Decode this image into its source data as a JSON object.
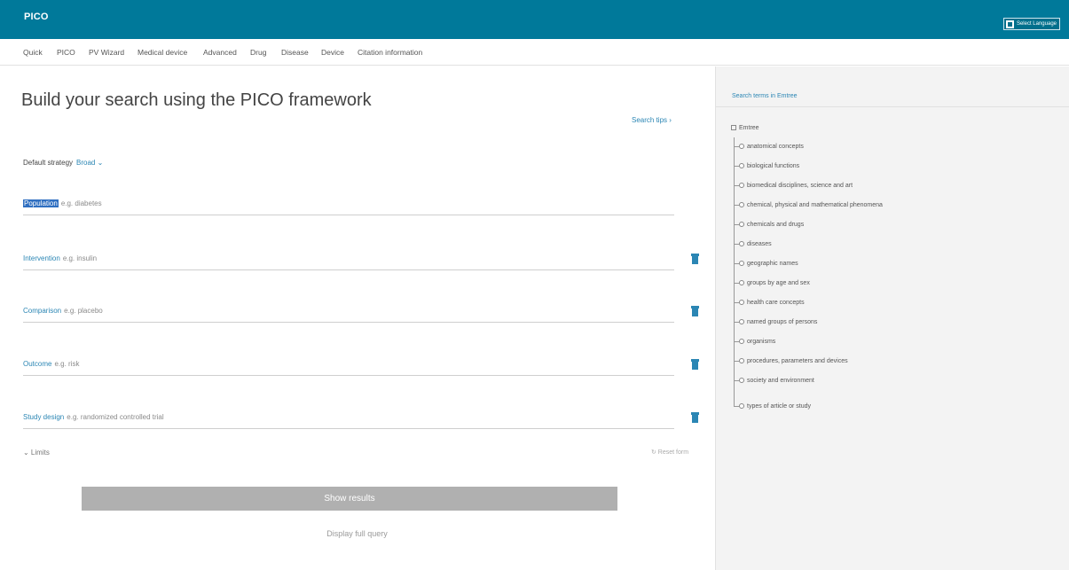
{
  "app": {
    "title": "PICO",
    "language_button": "Select Language"
  },
  "tabs": [
    "Quick",
    "PICO",
    "PV Wizard",
    "Medical device",
    "Advanced",
    "Drug",
    "Disease",
    "Device",
    "Citation information"
  ],
  "main": {
    "title": "Build your search using the PICO framework",
    "search_tips": "Search tips ›",
    "default_strategy_label": "Default strategy",
    "default_strategy_value": "Broad ⌄",
    "fields": [
      {
        "label": "Population",
        "placeholder": "e.g. diabetes",
        "highlighted": true
      },
      {
        "label": "Intervention",
        "placeholder": "e.g. insulin"
      },
      {
        "label": "Comparison",
        "placeholder": "e.g. placebo"
      },
      {
        "label": "Outcome",
        "placeholder": "e.g. risk"
      },
      {
        "label": "Study design",
        "placeholder": "e.g. randomized controlled trial"
      }
    ],
    "limits": "⌄ Limits",
    "reset_form": "↻ Reset form",
    "show_results": "Show results",
    "display_query": "Display full query"
  },
  "side": {
    "header": "Search terms in Emtree",
    "root": "Emtree",
    "items": [
      "anatomical concepts",
      "biological functions",
      "biomedical disciplines, science and art",
      "chemical, physical and mathematical phenomena",
      "chemicals and drugs",
      "diseases",
      "geographic names",
      "groups by age and sex",
      "health care concepts",
      "named groups of persons",
      "organisms",
      "procedures, parameters and devices",
      "society and environment",
      "types of article or study"
    ]
  },
  "colors": {
    "header_bg": "#00799a",
    "link": "#2b86b4",
    "button_disabled": "#b0b0b0"
  }
}
